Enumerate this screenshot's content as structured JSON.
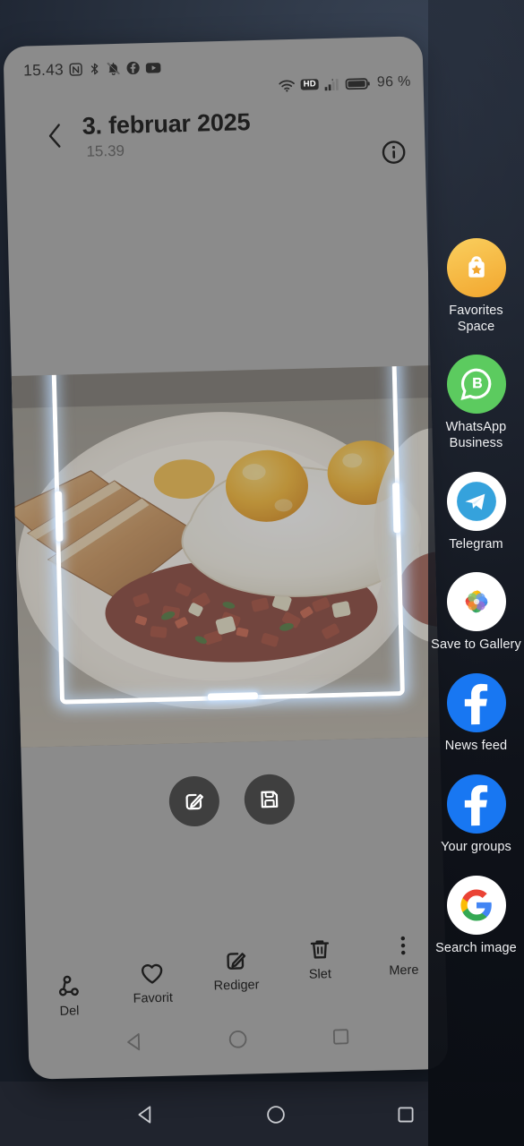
{
  "statusbar": {
    "time": "15.43",
    "battery_percent": "96 %",
    "hd_badge": "HD",
    "left_icons": [
      "nfc-icon",
      "bluetooth-icon",
      "notifications-muted-icon",
      "facebook-icon",
      "youtube-icon"
    ],
    "right_icons": [
      "wifi-icon",
      "hd-icon",
      "cellular-signal-icon",
      "battery-icon"
    ]
  },
  "header": {
    "back_label": "Tilbage",
    "title": "3. februar 2025",
    "subtitle": "15.39",
    "info_label": "Info"
  },
  "photo": {
    "alt": "Corned beef hash with two fried eggs and toast on a white plate",
    "crop_selected": true
  },
  "actions": {
    "edit_label": "Rediger billede",
    "save_label": "Gem billede"
  },
  "toolbar": {
    "items": [
      {
        "label": "Del",
        "icon": "share-icon"
      },
      {
        "label": "Favorit",
        "icon": "heart-icon"
      },
      {
        "label": "Rediger",
        "icon": "edit-icon"
      },
      {
        "label": "Slet",
        "icon": "trash-icon"
      },
      {
        "label": "Mere",
        "icon": "more-vertical-icon"
      }
    ]
  },
  "navbar": {
    "back": "Tilbage",
    "home": "Hjem",
    "recents": "Seneste"
  },
  "rail": {
    "items": [
      {
        "label": "Favorites Space",
        "icon": "favorites-space-icon",
        "color": "#F4B63F"
      },
      {
        "label": "WhatsApp Business",
        "icon": "whatsapp-business-icon",
        "color": "#5CCB5F"
      },
      {
        "label": "Telegram",
        "icon": "telegram-icon",
        "color": "#35A2DC"
      },
      {
        "label": "Save to Gallery",
        "icon": "google-photos-icon",
        "color": "#FFFFFF"
      },
      {
        "label": "News feed",
        "icon": "facebook-icon",
        "color": "#1877F2"
      },
      {
        "label": "Your groups",
        "icon": "facebook-icon",
        "color": "#1877F2"
      },
      {
        "label": "Search image",
        "icon": "google-icon",
        "color": "#FFFFFF"
      }
    ]
  },
  "colors": {
    "card_surface": "#8b8b8b",
    "crop_glow": "#bedcff",
    "wallpaper": "#2b3442",
    "rail_overlay": "#11151d"
  }
}
